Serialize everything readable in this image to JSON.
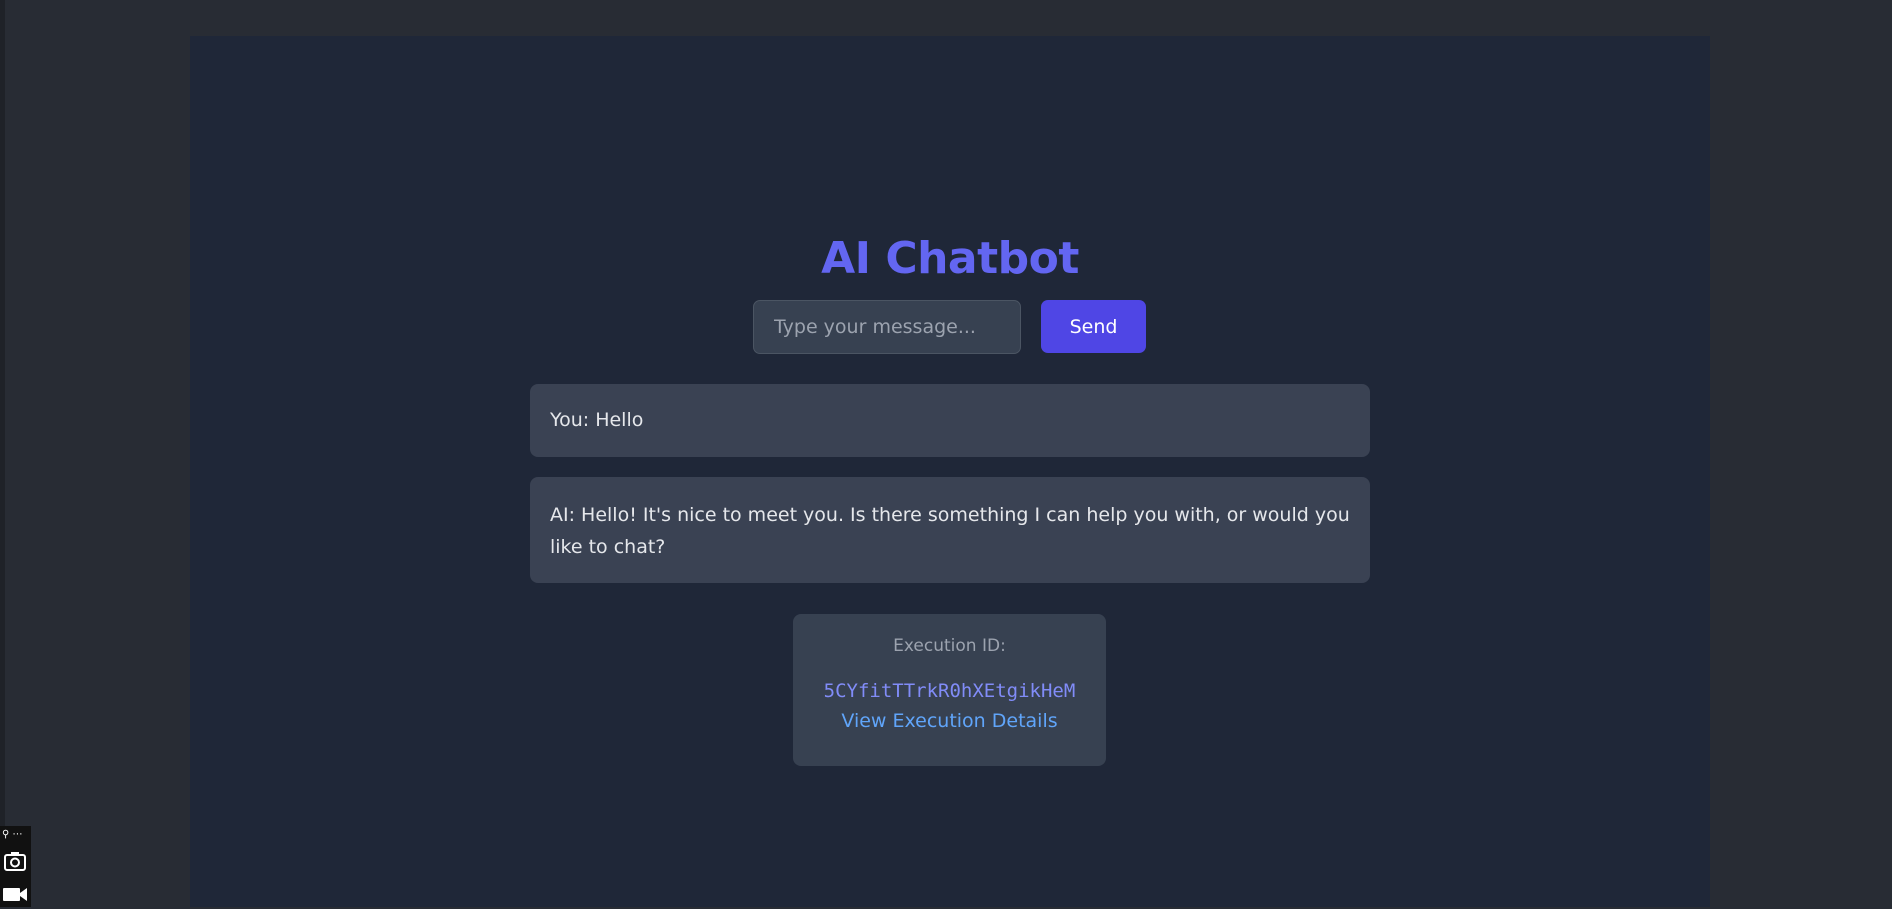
{
  "app": {
    "title": "AI Chatbot"
  },
  "composer": {
    "placeholder": "Type your message...",
    "value": "",
    "send_label": "Send"
  },
  "messages": [
    {
      "text": "You: Hello"
    },
    {
      "text": "AI: Hello! It's nice to meet you. Is there something I can help you with, or would you like to chat?"
    }
  ],
  "execution": {
    "label": "Execution ID:",
    "id": "5CYfitTTrkR0hXEtgikHeM",
    "link_label": "View Execution Details"
  },
  "capture_widget": {
    "top_label": "⚲ ⋯",
    "icons": [
      "camera-icon",
      "video-camera-icon"
    ]
  },
  "colors": {
    "title": "#6366f1",
    "send_button": "#4f46e5",
    "execution_id": "#818cf8",
    "link": "#60a5fa",
    "panel": "#1f2738",
    "bubble": "#3a4253"
  }
}
